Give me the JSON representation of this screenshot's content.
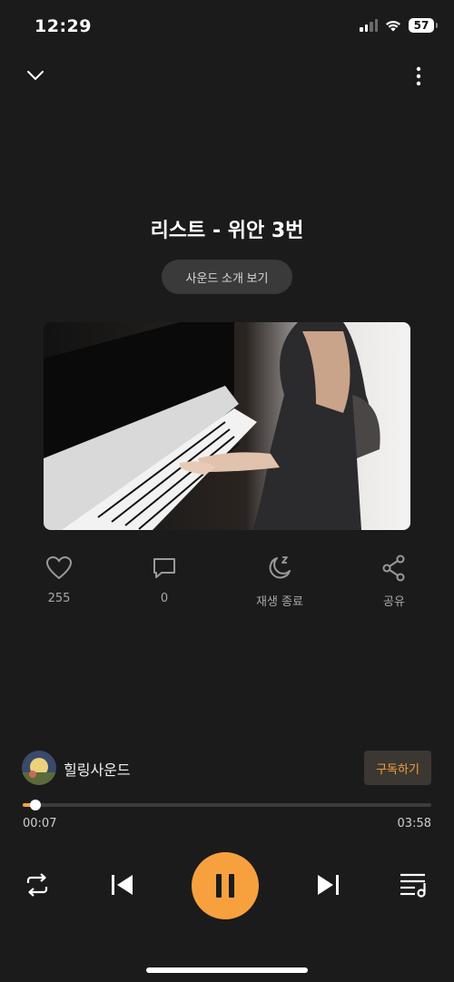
{
  "status_bar": {
    "time": "12:29",
    "battery": "57"
  },
  "header": {
    "collapse_icon": "chevron-down-icon",
    "more_icon": "more-vertical-icon"
  },
  "track": {
    "title": "리스트 - 위안 3번",
    "intro_label": "사운드 소개 보기"
  },
  "actions": [
    {
      "icon": "heart-icon",
      "label": "255"
    },
    {
      "icon": "comment-icon",
      "label": "0"
    },
    {
      "icon": "sleep-timer-icon",
      "label": "재생 종료"
    },
    {
      "icon": "share-icon",
      "label": "공유"
    }
  ],
  "channel": {
    "name": "힐링사운드",
    "subscribe_label": "구독하기"
  },
  "player": {
    "current_time": "00:07",
    "total_time": "03:58",
    "progress": 0.03,
    "controls": [
      "repeat-icon",
      "previous-icon",
      "pause-icon",
      "next-icon",
      "playlist-icon"
    ]
  },
  "colors": {
    "accent": "#f7a13e",
    "background": "#1b1b1b"
  }
}
